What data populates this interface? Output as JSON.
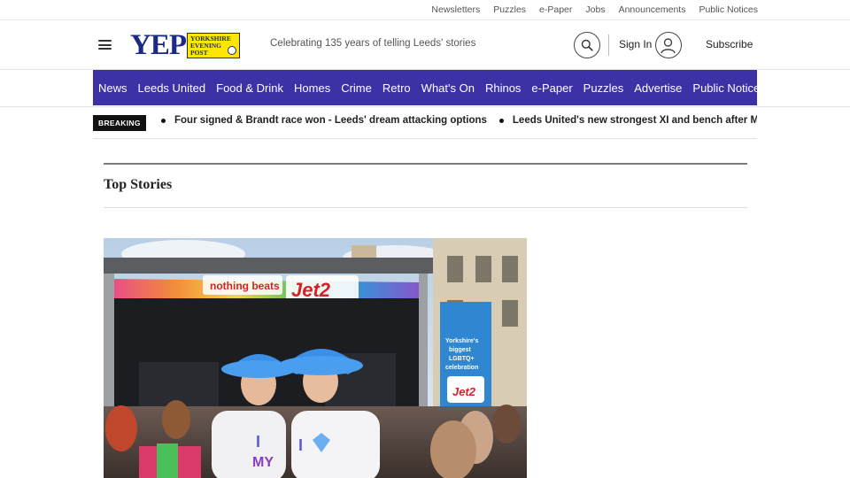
{
  "utility_links": [
    "Newsletters",
    "Puzzles",
    "e-Paper",
    "Jobs",
    "Announcements",
    "Public Notices"
  ],
  "header": {
    "logo_text": "YEP",
    "logo_box_lines": [
      "Yorkshire",
      "Evening",
      "Post"
    ],
    "tagline": "Celebrating 135 years of telling Leeds' stories",
    "signin_label": "Sign In",
    "subscribe_label": "Subscribe",
    "icons": {
      "menu": "hamburger-menu-icon",
      "search": "search-icon",
      "account": "user-avatar-icon"
    }
  },
  "nav": [
    "News",
    "Leeds United",
    "Food & Drink",
    "Homes",
    "Crime",
    "Retro",
    "What's On",
    "Rhinos",
    "e-Paper",
    "Puzzles",
    "Advertise",
    "Public Notices"
  ],
  "breaking": {
    "label": "BREAKING",
    "items": [
      "Four signed & Brandt race won - Leeds' dream attacking options",
      "Leeds United's new strongest XI and bench after Muharemovi"
    ]
  },
  "top_stories": {
    "title": "Top Stories",
    "hero_image": {
      "banner_text_1": "nothing beats",
      "banner_text_2": "Jet2",
      "side_banner_lines": [
        "Yorkshire's",
        "biggest",
        "LGBTQ+",
        "celebration"
      ],
      "side_banner_logo": "Jet2",
      "shirt_text_1": "I",
      "shirt_text_2": "MY"
    }
  },
  "colors": {
    "nav_bg": "#3d31a6",
    "logo_blue": "#1b2a86",
    "logo_yellow": "#ffe600",
    "breaking_bg": "#111111"
  }
}
